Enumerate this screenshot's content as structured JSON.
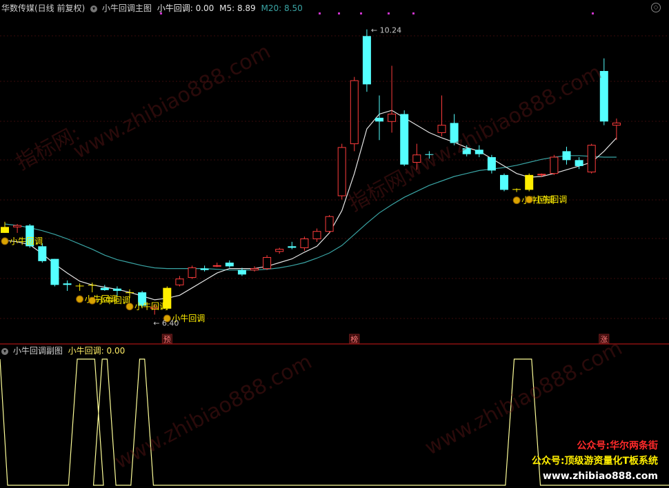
{
  "main_header": {
    "stock_label": "华数传媒(日线 前复权)",
    "indicator_name": "小牛回调主图",
    "signal_label": "小牛回调:",
    "signal_value": "0.00",
    "m5_label": "M5:",
    "m5_value": "8.89",
    "m20_label": "M20:",
    "m20_value": "8.50"
  },
  "sub_header": {
    "indicator_name": "小牛回调副图",
    "signal_label": "小牛回调:",
    "signal_value": "0.00"
  },
  "promo": {
    "line1": "公众号:华尔两条街",
    "line2": "公众号:顶级游资量化T板系统",
    "line3": "www.zhibiao888.com"
  },
  "watermarks": [
    "指标网:",
    "www.zhibiao888.com"
  ],
  "colors": {
    "up": "#ff3c3c",
    "down": "#54ffff",
    "signal_bar": "#ffee00",
    "ma5": "#e6e6e6",
    "ma20": "#3aa5a5",
    "subline": "#ffff99",
    "divider": "#8a1010",
    "promo_red": "#ff2a2a",
    "promo_yellow": "#ffee00"
  },
  "chart_data": {
    "type": "candlestick",
    "price_range": [
      6.2,
      10.45
    ],
    "max_annotation": "10.24",
    "min_annotation": "6.40",
    "candles": [
      {
        "o": 7.58,
        "h": 7.65,
        "l": 7.5,
        "c": 7.5,
        "t": "signal"
      },
      {
        "o": 7.6,
        "h": 7.62,
        "l": 7.5,
        "c": 7.58,
        "t": "up"
      },
      {
        "o": 7.6,
        "h": 7.62,
        "l": 7.3,
        "c": 7.32,
        "t": "down"
      },
      {
        "o": 7.32,
        "h": 7.36,
        "l": 7.1,
        "c": 7.12,
        "t": "down"
      },
      {
        "o": 7.15,
        "h": 7.15,
        "l": 6.78,
        "c": 6.8,
        "t": "down"
      },
      {
        "o": 6.82,
        "h": 6.86,
        "l": 6.72,
        "c": 6.8,
        "t": "down"
      },
      {
        "o": 6.79,
        "h": 6.82,
        "l": 6.72,
        "c": 6.79,
        "t": "signal"
      },
      {
        "o": 6.8,
        "h": 6.83,
        "l": 6.7,
        "c": 6.8,
        "t": "signal"
      },
      {
        "o": 6.76,
        "h": 6.8,
        "l": 6.72,
        "c": 6.73,
        "t": "down"
      },
      {
        "o": 6.75,
        "h": 6.78,
        "l": 6.65,
        "c": 6.72,
        "t": "down"
      },
      {
        "o": 6.7,
        "h": 6.74,
        "l": 6.62,
        "c": 6.69,
        "t": "signal"
      },
      {
        "o": 6.7,
        "h": 6.72,
        "l": 6.5,
        "c": 6.52,
        "t": "down"
      },
      {
        "o": 6.5,
        "h": 6.54,
        "l": 6.4,
        "c": 6.48,
        "t": "up"
      },
      {
        "o": 6.48,
        "h": 6.78,
        "l": 6.46,
        "c": 6.76,
        "t": "signal"
      },
      {
        "o": 6.8,
        "h": 6.92,
        "l": 6.78,
        "c": 6.88,
        "t": "up"
      },
      {
        "o": 6.9,
        "h": 7.06,
        "l": 6.88,
        "c": 7.03,
        "t": "up"
      },
      {
        "o": 7.02,
        "h": 7.06,
        "l": 6.98,
        "c": 7.0,
        "t": "down"
      },
      {
        "o": 7.06,
        "h": 7.1,
        "l": 7.04,
        "c": 7.06,
        "t": "up"
      },
      {
        "o": 7.1,
        "h": 7.13,
        "l": 7.03,
        "c": 7.05,
        "t": "down"
      },
      {
        "o": 7.0,
        "h": 7.03,
        "l": 6.92,
        "c": 6.94,
        "t": "down"
      },
      {
        "o": 7.0,
        "h": 7.05,
        "l": 6.98,
        "c": 7.02,
        "t": "up"
      },
      {
        "o": 7.02,
        "h": 7.2,
        "l": 7.0,
        "c": 7.17,
        "t": "up"
      },
      {
        "o": 7.25,
        "h": 7.3,
        "l": 7.22,
        "c": 7.28,
        "t": "up"
      },
      {
        "o": 7.32,
        "h": 7.38,
        "l": 7.28,
        "c": 7.3,
        "t": "down"
      },
      {
        "o": 7.3,
        "h": 7.45,
        "l": 7.26,
        "c": 7.42,
        "t": "up"
      },
      {
        "o": 7.42,
        "h": 7.56,
        "l": 7.38,
        "c": 7.52,
        "t": "up"
      },
      {
        "o": 7.52,
        "h": 7.74,
        "l": 7.5,
        "c": 7.72,
        "t": "up"
      },
      {
        "o": 8.0,
        "h": 8.7,
        "l": 7.95,
        "c": 8.65,
        "t": "up"
      },
      {
        "o": 8.7,
        "h": 9.6,
        "l": 8.6,
        "c": 9.55,
        "t": "up"
      },
      {
        "o": 10.15,
        "h": 10.24,
        "l": 9.4,
        "c": 9.5,
        "t": "down"
      },
      {
        "o": 9.05,
        "h": 9.35,
        "l": 8.75,
        "c": 9.0,
        "t": "down"
      },
      {
        "o": 9.0,
        "h": 9.75,
        "l": 8.85,
        "c": 9.1,
        "t": "up"
      },
      {
        "o": 9.1,
        "h": 9.15,
        "l": 8.4,
        "c": 8.42,
        "t": "down"
      },
      {
        "o": 8.45,
        "h": 8.7,
        "l": 8.35,
        "c": 8.55,
        "t": "up"
      },
      {
        "o": 8.56,
        "h": 8.6,
        "l": 8.5,
        "c": 8.55,
        "t": "down"
      },
      {
        "o": 8.85,
        "h": 9.35,
        "l": 8.8,
        "c": 8.95,
        "t": "up"
      },
      {
        "o": 8.98,
        "h": 9.1,
        "l": 8.68,
        "c": 8.71,
        "t": "down"
      },
      {
        "o": 8.64,
        "h": 8.68,
        "l": 8.53,
        "c": 8.56,
        "t": "down"
      },
      {
        "o": 8.62,
        "h": 8.68,
        "l": 8.52,
        "c": 8.56,
        "t": "down"
      },
      {
        "o": 8.52,
        "h": 8.55,
        "l": 8.3,
        "c": 8.34,
        "t": "down"
      },
      {
        "o": 8.28,
        "h": 8.3,
        "l": 8.06,
        "c": 8.08,
        "t": "down"
      },
      {
        "o": 8.09,
        "h": 8.1,
        "l": 8.05,
        "c": 8.08,
        "t": "signal"
      },
      {
        "o": 8.08,
        "h": 8.3,
        "l": 8.06,
        "c": 8.28,
        "t": "signal"
      },
      {
        "o": 8.28,
        "h": 8.3,
        "l": 8.25,
        "c": 8.29,
        "t": "up"
      },
      {
        "o": 8.3,
        "h": 8.55,
        "l": 8.28,
        "c": 8.52,
        "t": "up"
      },
      {
        "o": 8.6,
        "h": 8.66,
        "l": 8.42,
        "c": 8.48,
        "t": "down"
      },
      {
        "o": 8.48,
        "h": 8.52,
        "l": 8.36,
        "c": 8.4,
        "t": "down"
      },
      {
        "o": 8.32,
        "h": 8.7,
        "l": 8.3,
        "c": 8.68,
        "t": "up"
      },
      {
        "o": 9.68,
        "h": 9.85,
        "l": 8.95,
        "c": 9.0,
        "t": "down"
      },
      {
        "o": 8.95,
        "h": 9.04,
        "l": 8.75,
        "c": 8.98,
        "t": "up"
      }
    ],
    "ma5": [
      7.4,
      7.38,
      7.34,
      7.22,
      7.08,
      6.96,
      6.85,
      6.8,
      6.77,
      6.74,
      6.7,
      6.65,
      6.6,
      6.62,
      6.66,
      6.76,
      6.86,
      6.96,
      7.02,
      7.02,
      7.02,
      7.05,
      7.1,
      7.15,
      7.24,
      7.32,
      7.5,
      7.8,
      8.3,
      8.9,
      9.1,
      9.15,
      9.05,
      8.95,
      8.85,
      8.78,
      8.72,
      8.65,
      8.6,
      8.5,
      8.4,
      8.3,
      8.25,
      8.26,
      8.3,
      8.35,
      8.4,
      8.45,
      8.6,
      8.78
    ],
    "ma20": [
      7.62,
      7.6,
      7.57,
      7.53,
      7.48,
      7.42,
      7.35,
      7.28,
      7.2,
      7.14,
      7.1,
      7.06,
      7.03,
      7.02,
      7.02,
      7.02,
      7.02,
      7.01,
      7.0,
      7.0,
      7.0,
      7.01,
      7.03,
      7.06,
      7.1,
      7.16,
      7.23,
      7.33,
      7.48,
      7.63,
      7.77,
      7.88,
      7.98,
      8.06,
      8.14,
      8.2,
      8.26,
      8.3,
      8.34,
      8.36,
      8.38,
      8.41,
      8.45,
      8.49,
      8.52,
      8.54,
      8.54,
      8.53,
      8.52,
      8.52
    ],
    "signal_labels": [
      {
        "i": 0,
        "text": "小牛回调"
      },
      {
        "i": 6,
        "text": "小牛回调"
      },
      {
        "i": 7,
        "text": "小牛回调"
      },
      {
        "i": 10,
        "text": "小牛回调"
      },
      {
        "i": 13,
        "text": "小牛回调"
      },
      {
        "i": 41,
        "text": "小牛回调"
      },
      {
        "i": 42,
        "text": "小牛回调"
      }
    ],
    "markers": [
      {
        "i": 13,
        "text": "预"
      },
      {
        "i": 28,
        "text": "榜"
      },
      {
        "i": 48,
        "text": "涨"
      }
    ],
    "sub_peaks": [
      [
        6,
        7
      ],
      [
        8,
        8
      ],
      [
        11,
        11
      ],
      [
        41,
        42
      ]
    ]
  }
}
